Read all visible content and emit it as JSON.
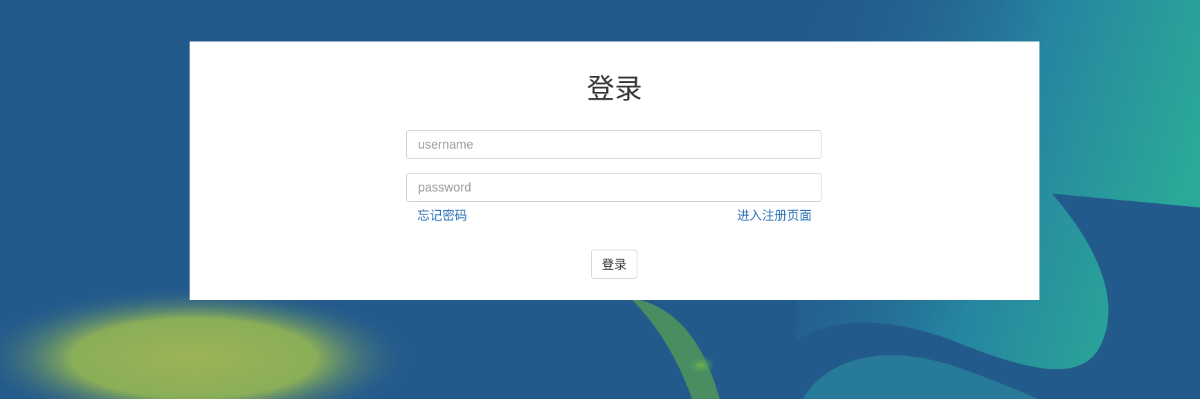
{
  "login": {
    "title": "登录",
    "username_placeholder": "username",
    "password_placeholder": "password",
    "forgot_password_link": "忘记密码",
    "register_link": "进入注册页面",
    "submit_label": "登录"
  },
  "theme": {
    "background_primary": "#235a8c",
    "background_accent_green": "#6fb446",
    "background_accent_teal": "#2aa898",
    "card_background": "#ffffff",
    "link_color": "#2a6fb6",
    "title_color": "#333333"
  }
}
